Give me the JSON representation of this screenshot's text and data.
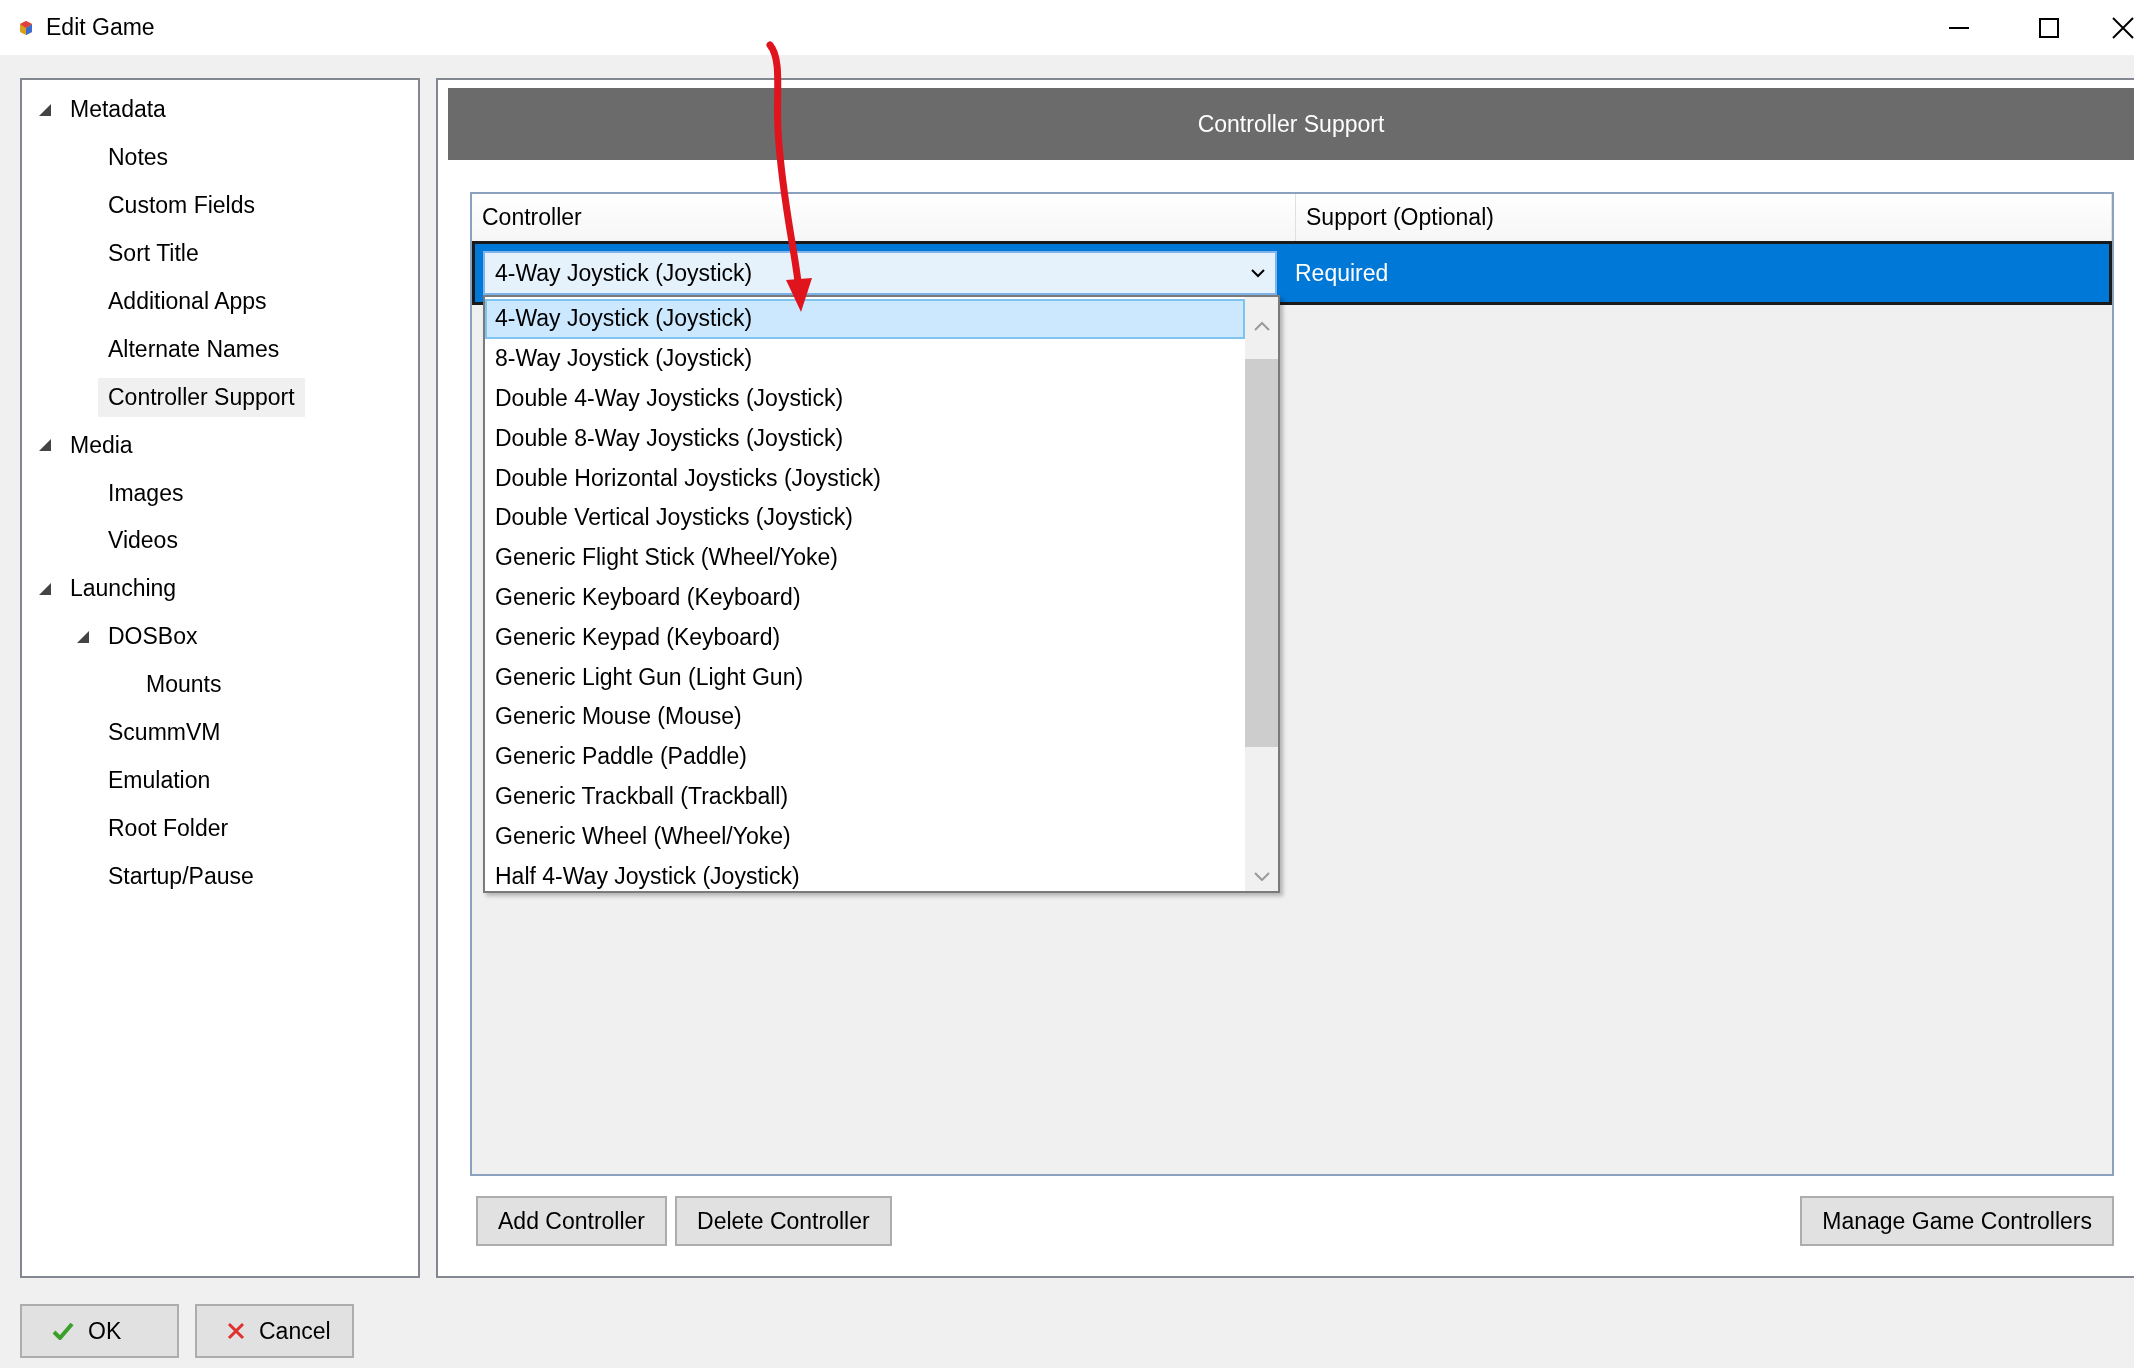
{
  "window": {
    "title": "Edit Game"
  },
  "sidebar": {
    "items": [
      {
        "label": "Metadata",
        "expanded": true,
        "selected": false,
        "children": [
          {
            "label": "Notes",
            "selected": false
          },
          {
            "label": "Custom Fields",
            "selected": false
          },
          {
            "label": "Sort Title",
            "selected": false
          },
          {
            "label": "Additional Apps",
            "selected": false
          },
          {
            "label": "Alternate Names",
            "selected": false
          },
          {
            "label": "Controller Support",
            "selected": true
          }
        ]
      },
      {
        "label": "Media",
        "expanded": true,
        "selected": false,
        "children": [
          {
            "label": "Images",
            "selected": false
          },
          {
            "label": "Videos",
            "selected": false
          }
        ]
      },
      {
        "label": "Launching",
        "expanded": true,
        "selected": false,
        "children": [
          {
            "label": "DOSBox",
            "expanded": true,
            "selected": false,
            "children": [
              {
                "label": "Mounts",
                "selected": false
              }
            ]
          },
          {
            "label": "ScummVM",
            "selected": false
          },
          {
            "label": "Emulation",
            "selected": false
          },
          {
            "label": "Root Folder",
            "selected": false
          },
          {
            "label": "Startup/Pause",
            "selected": false
          }
        ]
      }
    ]
  },
  "panel": {
    "title": "Controller Support",
    "table": {
      "columns": [
        "Controller",
        "Support (Optional)"
      ],
      "rows": [
        {
          "controller": "4-Way Joystick (Joystick)",
          "support": "Required",
          "selected": true
        }
      ]
    },
    "dropdown": {
      "options": [
        {
          "label": "4-Way Joystick (Joystick)",
          "selected": true
        },
        {
          "label": "8-Way Joystick (Joystick)",
          "selected": false
        },
        {
          "label": "Double 4-Way Joysticks (Joystick)",
          "selected": false
        },
        {
          "label": "Double 8-Way Joysticks (Joystick)",
          "selected": false
        },
        {
          "label": "Double Horizontal Joysticks (Joystick)",
          "selected": false
        },
        {
          "label": "Double Vertical Joysticks (Joystick)",
          "selected": false
        },
        {
          "label": "Generic Flight Stick (Wheel/Yoke)",
          "selected": false
        },
        {
          "label": "Generic Keyboard (Keyboard)",
          "selected": false
        },
        {
          "label": "Generic Keypad (Keyboard)",
          "selected": false
        },
        {
          "label": "Generic Light Gun (Light Gun)",
          "selected": false
        },
        {
          "label": "Generic Mouse (Mouse)",
          "selected": false
        },
        {
          "label": "Generic Paddle (Paddle)",
          "selected": false
        },
        {
          "label": "Generic Trackball (Trackball)",
          "selected": false
        },
        {
          "label": "Generic Wheel (Wheel/Yoke)",
          "selected": false
        },
        {
          "label": "Half 4-Way Joystick (Joystick)",
          "selected": false
        }
      ]
    },
    "buttons": [
      "Add Controller",
      "Delete Controller"
    ],
    "side_buttons": [
      "Manage Game Controllers"
    ]
  },
  "dialog_buttons": [
    {
      "label": "OK",
      "kind": "ok"
    },
    {
      "label": "Cancel",
      "kind": "cancel"
    }
  ]
}
